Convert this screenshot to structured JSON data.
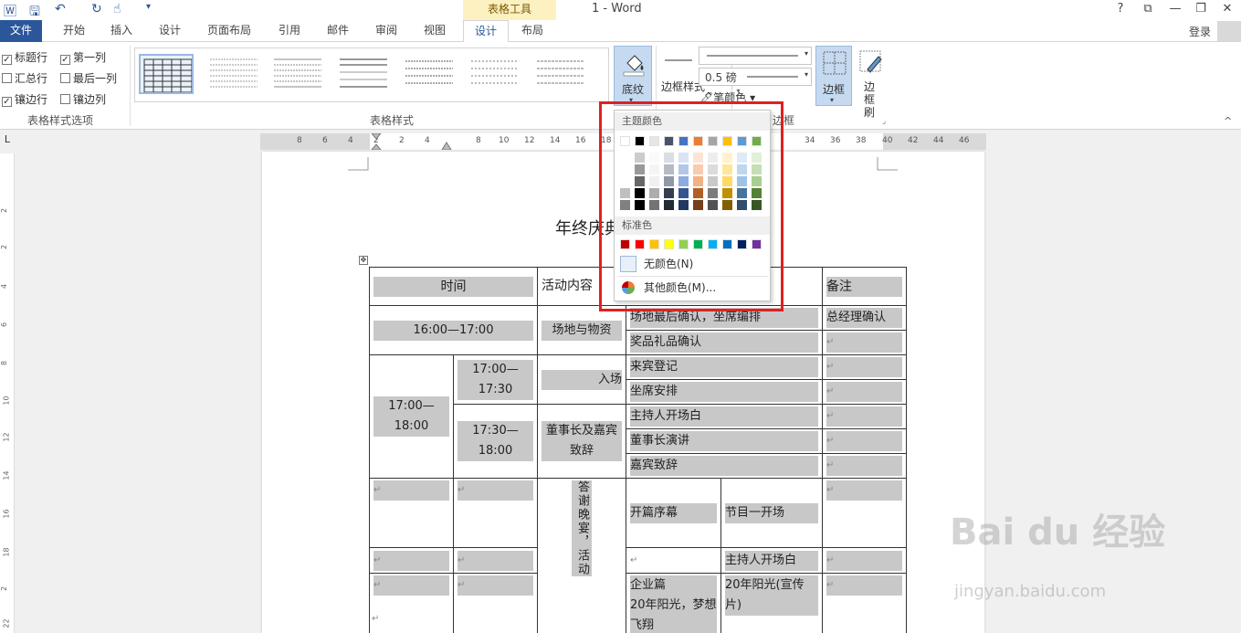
{
  "titlebar": {
    "doc_title": "1 - Word",
    "context_tab_group": "表格工具",
    "help": "?",
    "restore": "⧉",
    "minimize": "—",
    "maximize": "❐",
    "close": "✕"
  },
  "tabs": {
    "file": "文件",
    "items": [
      "开始",
      "插入",
      "设计",
      "页面布局",
      "引用",
      "邮件",
      "审阅",
      "视图"
    ],
    "design": "设计",
    "layout": "布局",
    "login": "登录"
  },
  "ribbon": {
    "options": {
      "header_row": "标题行",
      "first_column": "第一列",
      "total_row": "汇总行",
      "last_column": "最后一列",
      "banded_rows": "镶边行",
      "banded_columns": "镶边列",
      "group_label": "表格样式选项"
    },
    "styles_group_label": "表格样式",
    "shading": "底纹",
    "border_styles": "边框样式",
    "pen_weight": "0.5 磅",
    "pen_color": "笔颜色",
    "borders": "边框",
    "border_painter": "边框刷",
    "borders_group_label": "边框"
  },
  "ruler": {
    "ticks": [
      "8",
      "6",
      "4",
      "2",
      "2",
      "4",
      "8",
      "10",
      "12",
      "14",
      "16",
      "18",
      "34",
      "36",
      "38",
      "40",
      "42",
      "44",
      "46"
    ]
  },
  "vruler": {
    "ticks": [
      "2",
      "2",
      "4",
      "6",
      "8",
      "10",
      "12",
      "14",
      "16",
      "18",
      "2",
      "22",
      "24"
    ]
  },
  "document": {
    "heading": "年终庆典",
    "table": {
      "header": [
        "时间",
        "活动内容",
        "备注"
      ],
      "rows": {
        "r1_time": "16:00—17:00",
        "r1_cat": "场地与物资",
        "r1_item1": "场地最后确认，坐席编排",
        "r1_note1": "总经理确认",
        "r1_item2": "奖品礼品确认",
        "r2_time": "17:00—18:00",
        "r2_sub1": "17:00—17:30",
        "r2_sub2": "17:30—18:00",
        "r2_cat1": "入场",
        "r2_item1": "来宾登记",
        "r2_item2": "坐席安排",
        "r2_cat2": "董事长及嘉宾致辞",
        "r2_item3": "主持人开场白",
        "r2_item4": "董事长演讲",
        "r2_item5": "嘉宾致辞",
        "r3_cat": "答谢晚宴，活动",
        "r3_item1": "开篇序幕",
        "r3_item2": "节目一开场",
        "r3_item3": "主持人开场白",
        "r3_item4": "企业篇\n20年阳光，梦想飞翔",
        "r3_item5": "20年阳光(宣传片)"
      },
      "mark": "↵"
    }
  },
  "color_menu": {
    "theme_label": "主题颜色",
    "standard_label": "标准色",
    "no_color": "无颜色(N)",
    "more_colors": "其他颜色(M)...",
    "theme_top": [
      "#ffffff",
      "#000000",
      "#e7e6e6",
      "#44546a",
      "#4472c4",
      "#ed7d31",
      "#a5a5a5",
      "#ffc000",
      "#5b9bd5",
      "#70ad47"
    ],
    "standard": [
      "#c00000",
      "#ff0000",
      "#ffc000",
      "#ffff00",
      "#92d050",
      "#00b050",
      "#00b0f0",
      "#0070c0",
      "#002060",
      "#7030a0"
    ]
  },
  "watermark": {
    "brand": "Bai du 经验",
    "url": "jingyan.baidu.com"
  }
}
